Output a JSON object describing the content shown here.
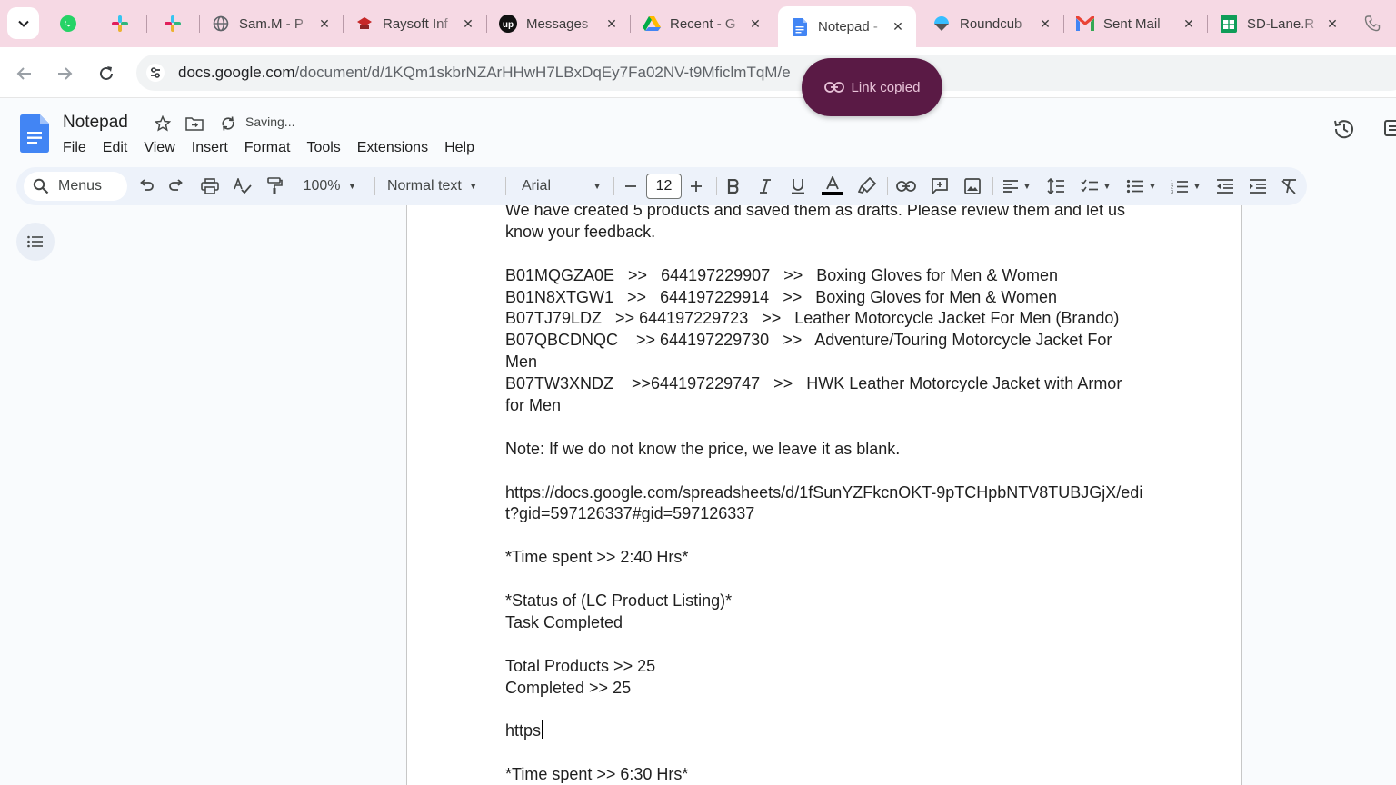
{
  "browser": {
    "tabs": [
      {
        "id": "whatsapp",
        "title": "",
        "pinned": true,
        "icon": "whatsapp-icon"
      },
      {
        "id": "slack1",
        "title": "",
        "pinned": true,
        "icon": "slack-icon"
      },
      {
        "id": "slack2",
        "title": "",
        "pinned": true,
        "icon": "slack-icon"
      },
      {
        "id": "sam",
        "title": "Sam.M - P",
        "icon": "globe-icon"
      },
      {
        "id": "raysoft",
        "title": "Raysoft Inf",
        "icon": "raysoft-icon"
      },
      {
        "id": "messages",
        "title": "Messages",
        "icon": "upwork-icon"
      },
      {
        "id": "recent",
        "title": "Recent - G",
        "icon": "google-drive-icon"
      },
      {
        "id": "notepad",
        "title": "Notepad -",
        "icon": "google-docs-icon",
        "active": true
      },
      {
        "id": "roundcube",
        "title": "Roundcub",
        "icon": "roundcube-icon"
      },
      {
        "id": "sentmail",
        "title": "Sent Mail",
        "icon": "gmail-icon"
      },
      {
        "id": "sdlane",
        "title": "SD-Lane.R",
        "icon": "google-sheets-icon"
      }
    ],
    "url_host": "docs.google.com",
    "url_path": "/document/d/1KQm1skbrNZArHHwH7LBxDqEy7Fa02NV-t9MficlmTqM/e",
    "toast": "Link copied"
  },
  "doc": {
    "title": "Notepad",
    "status": "Saving...",
    "menus": [
      "File",
      "Edit",
      "View",
      "Insert",
      "Format",
      "Tools",
      "Extensions",
      "Help"
    ]
  },
  "toolbar": {
    "search_label": "Menus",
    "zoom": "100%",
    "style": "Normal text",
    "font": "Arial",
    "font_size": "12"
  },
  "content": {
    "lines": [
      "We have created 5 products and saved them as drafts. Please review them and let us",
      "know your feedback.",
      "",
      "B01MQGZA0E   >>   644197229907   >>   Boxing Gloves for Men & Women",
      "B01N8XTGW1   >>   644197229914   >>   Boxing Gloves for Men & Women",
      "B07TJ79LDZ   >> 644197229723   >>   Leather Motorcycle Jacket For Men (Brando)",
      "B07QBCDNQC    >> 644197229730   >>   Adventure/Touring Motorcycle Jacket For",
      "Men",
      "B07TW3XNDZ    >>644197229747   >>   HWK Leather Motorcycle Jacket with Armor",
      "for Men",
      "",
      "Note: If we do not know the price, we leave it as blank.",
      "",
      "https://docs.google.com/spreadsheets/d/1fSunYZFkcnOKT-9pTCHpbNTV8TUBJGjX/edi",
      "t?gid=597126337#gid=597126337",
      "",
      "*Time spent >> 2:40 Hrs*",
      "",
      "*Status of (LC Product Listing)*",
      "Task Completed",
      "",
      "Total Products >> 25",
      "Completed >> 25",
      "",
      "https",
      "",
      "*Time spent >> 6:30 Hrs*"
    ]
  },
  "colors": {
    "tabbar": "#f6d9e4",
    "toast_bg": "#5a1a45",
    "docs_blue": "#4285f4",
    "toolbar_bg": "#edf2fa"
  }
}
